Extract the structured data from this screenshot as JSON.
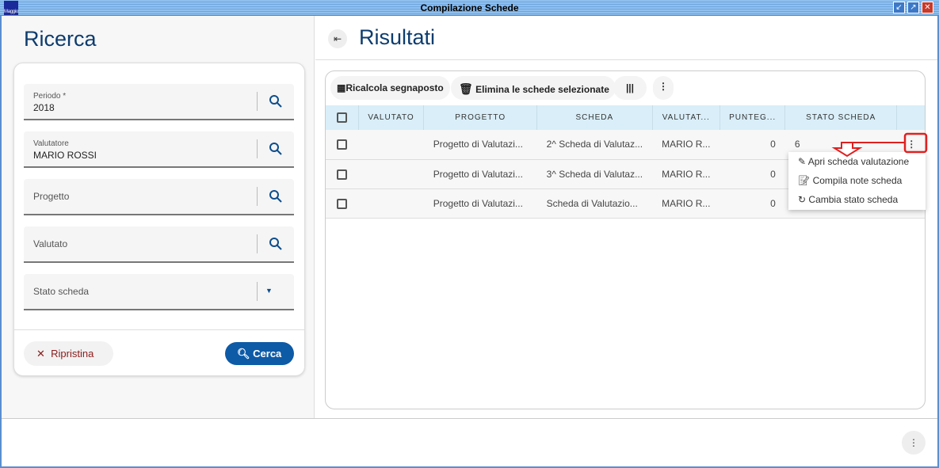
{
  "window": {
    "title": "Compilazione Schede",
    "app_icon_text": "Maggioli"
  },
  "search": {
    "title": "Ricerca",
    "fields": [
      {
        "label": "Periodo *",
        "value": "2018"
      },
      {
        "label": "Valutatore",
        "value": "MARIO ROSSI"
      },
      {
        "label": "Progetto",
        "value": ""
      },
      {
        "label": "Valutato",
        "value": ""
      },
      {
        "label": "Stato scheda",
        "value": ""
      }
    ],
    "reset_label": "Ripristina",
    "search_label": "Cerca"
  },
  "results": {
    "title": "Risultati",
    "toolbar": {
      "recalc": "Ricalcola segnaposto",
      "delete": "Elimina le schede selezionate"
    },
    "columns": [
      "VALUTATO",
      "PROGETTO",
      "SCHEDA",
      "VALUTAT...",
      "PUNTEG...",
      "STATO SCHEDA"
    ],
    "rows": [
      {
        "valutato": "",
        "progetto": "Progetto di Valutazi...",
        "scheda": "2^ Scheda di Valutaz...",
        "valutatore": "MARIO R...",
        "punteggio": "0",
        "stato": "6"
      },
      {
        "valutato": "",
        "progetto": "Progetto di Valutazi...",
        "scheda": "3^ Scheda di Valutaz...",
        "valutatore": "MARIO R...",
        "punteggio": "0",
        "stato": ""
      },
      {
        "valutato": "",
        "progetto": "Progetto di Valutazi...",
        "scheda": "Scheda di Valutazio...",
        "valutatore": "MARIO R...",
        "punteggio": "0",
        "stato": ""
      }
    ],
    "menu": [
      "Apri scheda valutazione",
      "Compila note scheda",
      "Cambia stato scheda"
    ]
  },
  "colors": {
    "primary": "#0d5aa7",
    "header_bg": "#d9eef8",
    "annotation": "#e02020"
  }
}
